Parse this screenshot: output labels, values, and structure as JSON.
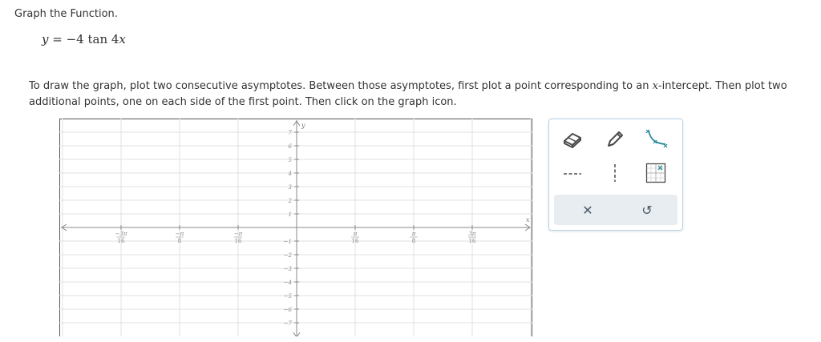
{
  "question": {
    "title": "Graph the Function.",
    "equation_y": "y",
    "equation_rhs": " = −4 tan 4",
    "equation_x": "x"
  },
  "instructions": {
    "part1": "To draw the graph, plot two consecutive asymptotes. Between those asymptotes, first plot a point corresponding to an ",
    "var": "x",
    "part2": "-intercept. Then plot two additional points, one on each side of the first point. Then click on the graph icon."
  },
  "graph": {
    "x_axis_label": "x",
    "y_axis_label": "y",
    "x_ticks": [
      {
        "num": "−3π",
        "den": "16"
      },
      {
        "num": "−π",
        "den": "8"
      },
      {
        "num": "−π",
        "den": "16"
      },
      {
        "num": "π",
        "den": "16"
      },
      {
        "num": "π",
        "den": "8"
      },
      {
        "num": "3π",
        "den": "16"
      }
    ],
    "y_ticks": [
      "7",
      "6",
      "5",
      "4",
      "3",
      "2",
      "1",
      "−1",
      "−2",
      "−3",
      "−4",
      "−5",
      "−6",
      "−7"
    ]
  },
  "toolbox": {
    "tools": [
      {
        "name": "eraser-icon"
      },
      {
        "name": "pencil-icon"
      },
      {
        "name": "tangent-curve-icon"
      },
      {
        "name": "dashed-line-icon"
      },
      {
        "name": "vertical-asymptote-icon"
      },
      {
        "name": "grid-icon"
      }
    ],
    "clear_symbol": "✕",
    "undo_symbol": "↺"
  },
  "colors": {
    "toolbox_border": "#b9d4e8",
    "tool_accent": "#2a8a9a",
    "bar_background": "#e8edf1",
    "grid_line": "#e1e1e1",
    "axis": "#888888"
  }
}
